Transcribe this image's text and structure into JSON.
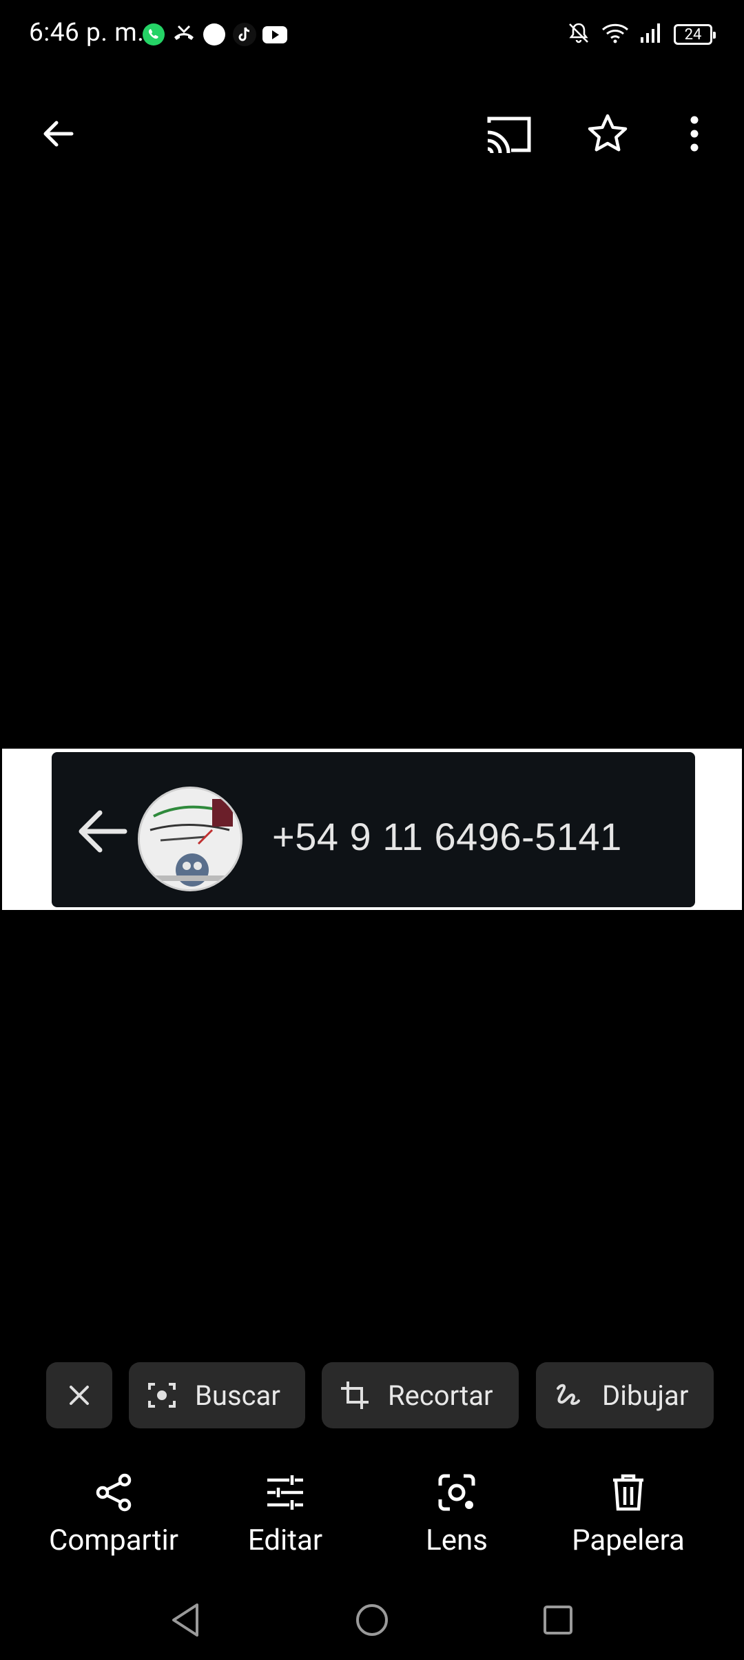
{
  "status_bar": {
    "time": "6:46 p. m.",
    "battery": "24",
    "left_icons": [
      "whatsapp-icon",
      "missed-call-icon",
      "dot-icon",
      "tiktok-icon",
      "youtube-icon"
    ],
    "right_icons": [
      "mute-bell-icon",
      "wifi-icon",
      "signal-icon",
      "battery-icon"
    ]
  },
  "top_bar": {
    "icons": [
      "back-arrow-icon",
      "cast-icon",
      "star-icon",
      "more-vert-icon"
    ]
  },
  "photo": {
    "phone_number": "+54 9 11 6496-5141"
  },
  "chips": {
    "close_icon": "close-icon",
    "search_label": "Buscar",
    "crop_label": "Recortar",
    "draw_label": "Dibujar"
  },
  "actions": {
    "share_label": "Compartir",
    "edit_label": "Editar",
    "lens_label": "Lens",
    "trash_label": "Papelera"
  },
  "colors": {
    "background": "#000000",
    "chip_bg": "#2a2a2a",
    "text": "#ffffff",
    "whatsapp": "#25D366"
  }
}
